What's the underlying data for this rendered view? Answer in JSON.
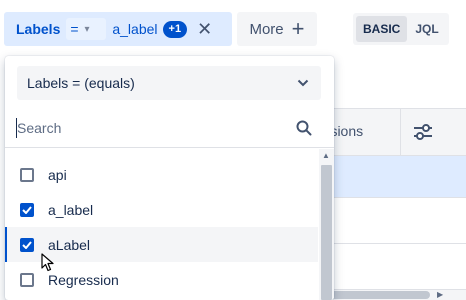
{
  "filter_bar": {
    "labels_chip": {
      "field_label": "Labels",
      "operator": "=",
      "value": "a_label",
      "extra_count": "+1"
    },
    "more_button": {
      "label": "More",
      "icon": "plus-icon"
    }
  },
  "mode_switch": {
    "basic_label": "BASIC",
    "jql_label": "JQL",
    "selected": "BASIC"
  },
  "background": {
    "column_header_partial": "ersions"
  },
  "dropdown": {
    "operator_select": "Labels = (equals)",
    "search_placeholder": "Search",
    "search_value": "",
    "options": [
      {
        "label": "api",
        "checked": false
      },
      {
        "label": "a_label",
        "checked": true
      },
      {
        "label": "aLabel",
        "checked": true,
        "hovered": true
      },
      {
        "label": "Regression",
        "checked": false
      }
    ]
  },
  "colors": {
    "accent": "#0052cc",
    "chip_bg": "#deebff",
    "neutral_bg": "#f4f5f7"
  }
}
